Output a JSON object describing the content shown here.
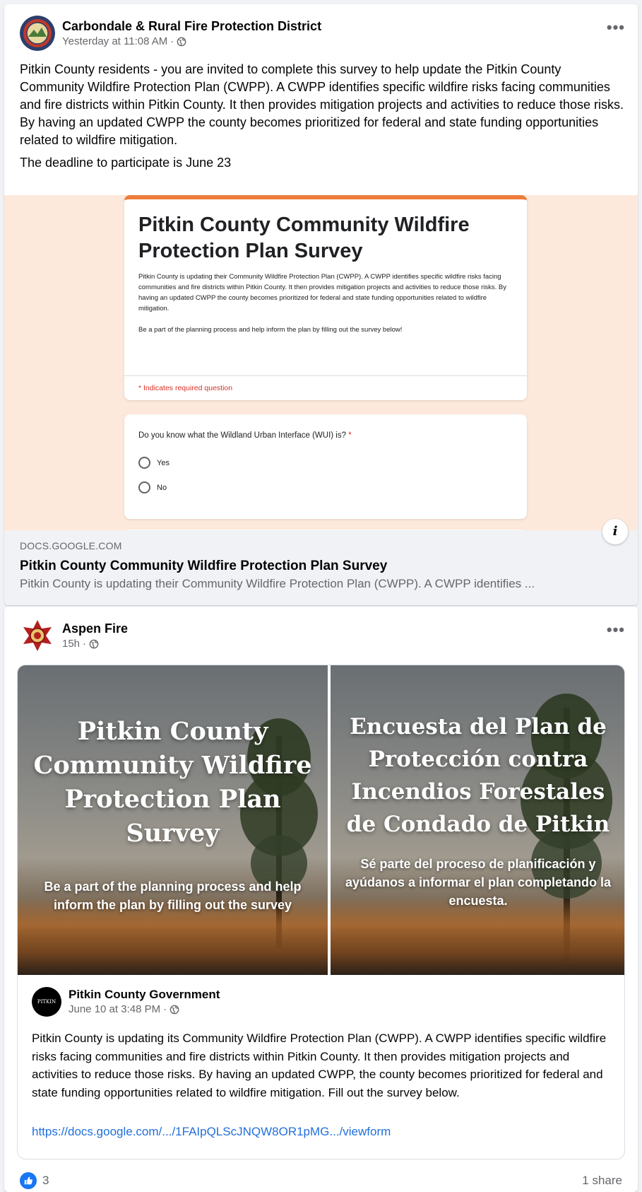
{
  "post1": {
    "page_name": "Carbondale & Rural Fire Protection District",
    "timestamp": "Yesterday at 11:08 AM",
    "separator": "·",
    "more_label": "•••",
    "body": "Pitkin County residents - you are invited to complete this survey to help update the Pitkin County Community Wildfire Protection Plan (CWPP).  A CWPP identifies specific wildfire risks facing communities and fire districts within Pitkin County. It then provides mitigation projects and activities to reduce those risks. By having an updated CWPP the county becomes prioritized for federal and state funding opportunities related to wildfire mitigation.",
    "deadline": "The deadline to participate is June 23",
    "form": {
      "title": "Pitkin County Community Wildfire Protection Plan Survey",
      "description": "Pitkin County is updating their Community Wildfire Protection Plan (CWPP). A CWPP identifies specific wildfire risks facing communities and fire districts within Pitkin County. It then provides mitigation projects and activities to reduce those risks. By having an updated CWPP the county becomes prioritized for federal and state funding opportunities related to wildfire mitigation.",
      "cta": "Be a part of the planning process and help inform the plan by filling out the survey below!",
      "required_note": "* Indicates required question",
      "question": "Do you know what the Wildland Urban Interface (WUI) is?",
      "required_star": "*",
      "options": [
        "Yes",
        "No"
      ]
    },
    "info_label": "i",
    "link": {
      "domain": "DOCS.GOOGLE.COM",
      "title": "Pitkin County Community Wildfire Protection Plan Survey",
      "description": "Pitkin County is updating their Community Wildfire Protection Plan (CWPP). A CWPP identifies ..."
    }
  },
  "post2": {
    "page_name": "Aspen Fire",
    "timestamp": "15h",
    "separator": "·",
    "more_label": "•••",
    "image_left": {
      "title": "Pitkin County Community Wildfire Protection Plan Survey",
      "subtitle": "Be a part of the planning process and help inform the plan by filling out the survey"
    },
    "image_right": {
      "title": "Encuesta del Plan de Protección contra Incendios Forestales de Condado de Pitkin",
      "subtitle": "Sé parte del proceso de planificación y ayúdanos a informar el plan completando la encuesta."
    },
    "shared": {
      "page_name": "Pitkin County Government",
      "timestamp": "June 10 at 3:48 PM",
      "separator": "·",
      "avatar_text": "PITKIN COUNTY",
      "body": "Pitkin County is updating its Community Wildfire Protection Plan (CWPP). A CWPP identifies specific wildfire risks facing communities and fire districts within Pitkin County. It then provides mitigation projects and activities to reduce those risks. By having an updated CWPP, the county becomes prioritized for federal and state funding opportunities related to wildfire mitigation. Fill out the survey below.",
      "link": "https://docs.google.com/.../1FAIpQLScJNQW8OR1pMG.../viewform"
    },
    "reactions_count": "3",
    "shares": "1 share"
  },
  "colors": {
    "link_blue": "#216fdb",
    "like_blue": "#1877f2",
    "form_accent": "#ee7d3b",
    "preview_bg": "#fde9dc"
  }
}
